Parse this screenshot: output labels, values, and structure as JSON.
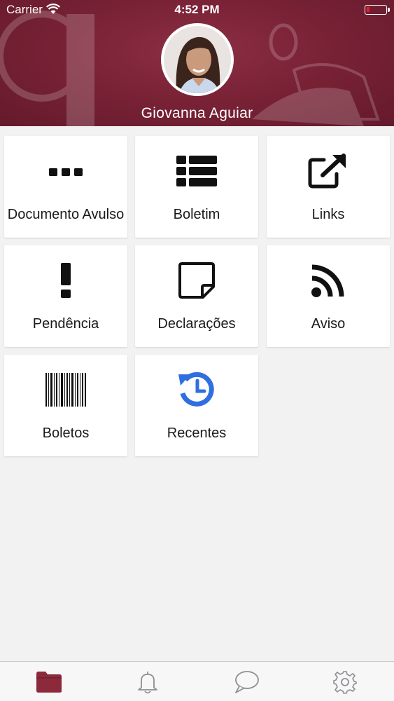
{
  "status_bar": {
    "carrier": "Carrier",
    "time": "4:52 PM",
    "wifi_icon": "wifi-icon",
    "battery_icon": "battery-low-icon"
  },
  "header": {
    "user_name": "Giovanna Aguiar",
    "avatar": "profile-photo",
    "background_color": "#7a2236"
  },
  "tiles": [
    {
      "label": "Documento Avulso",
      "icon": "ellipsis-icon"
    },
    {
      "label": "Boletim",
      "icon": "list-icon"
    },
    {
      "label": "Links",
      "icon": "external-link-icon"
    },
    {
      "label": "Pendência",
      "icon": "exclamation-icon"
    },
    {
      "label": "Declarações",
      "icon": "sticky-note-icon"
    },
    {
      "label": "Aviso",
      "icon": "rss-icon"
    },
    {
      "label": "Boletos",
      "icon": "barcode-icon"
    },
    {
      "label": "Recentes",
      "icon": "history-icon"
    }
  ],
  "tab_bar": {
    "tabs": [
      {
        "icon": "folder-icon",
        "active": true
      },
      {
        "icon": "bell-icon",
        "active": false
      },
      {
        "icon": "chat-icon",
        "active": false
      },
      {
        "icon": "gear-icon",
        "active": false
      }
    ],
    "active_color": "#8c2a3c",
    "inactive_color": "#8e8e93"
  },
  "accent_color": "#2f6fe0"
}
